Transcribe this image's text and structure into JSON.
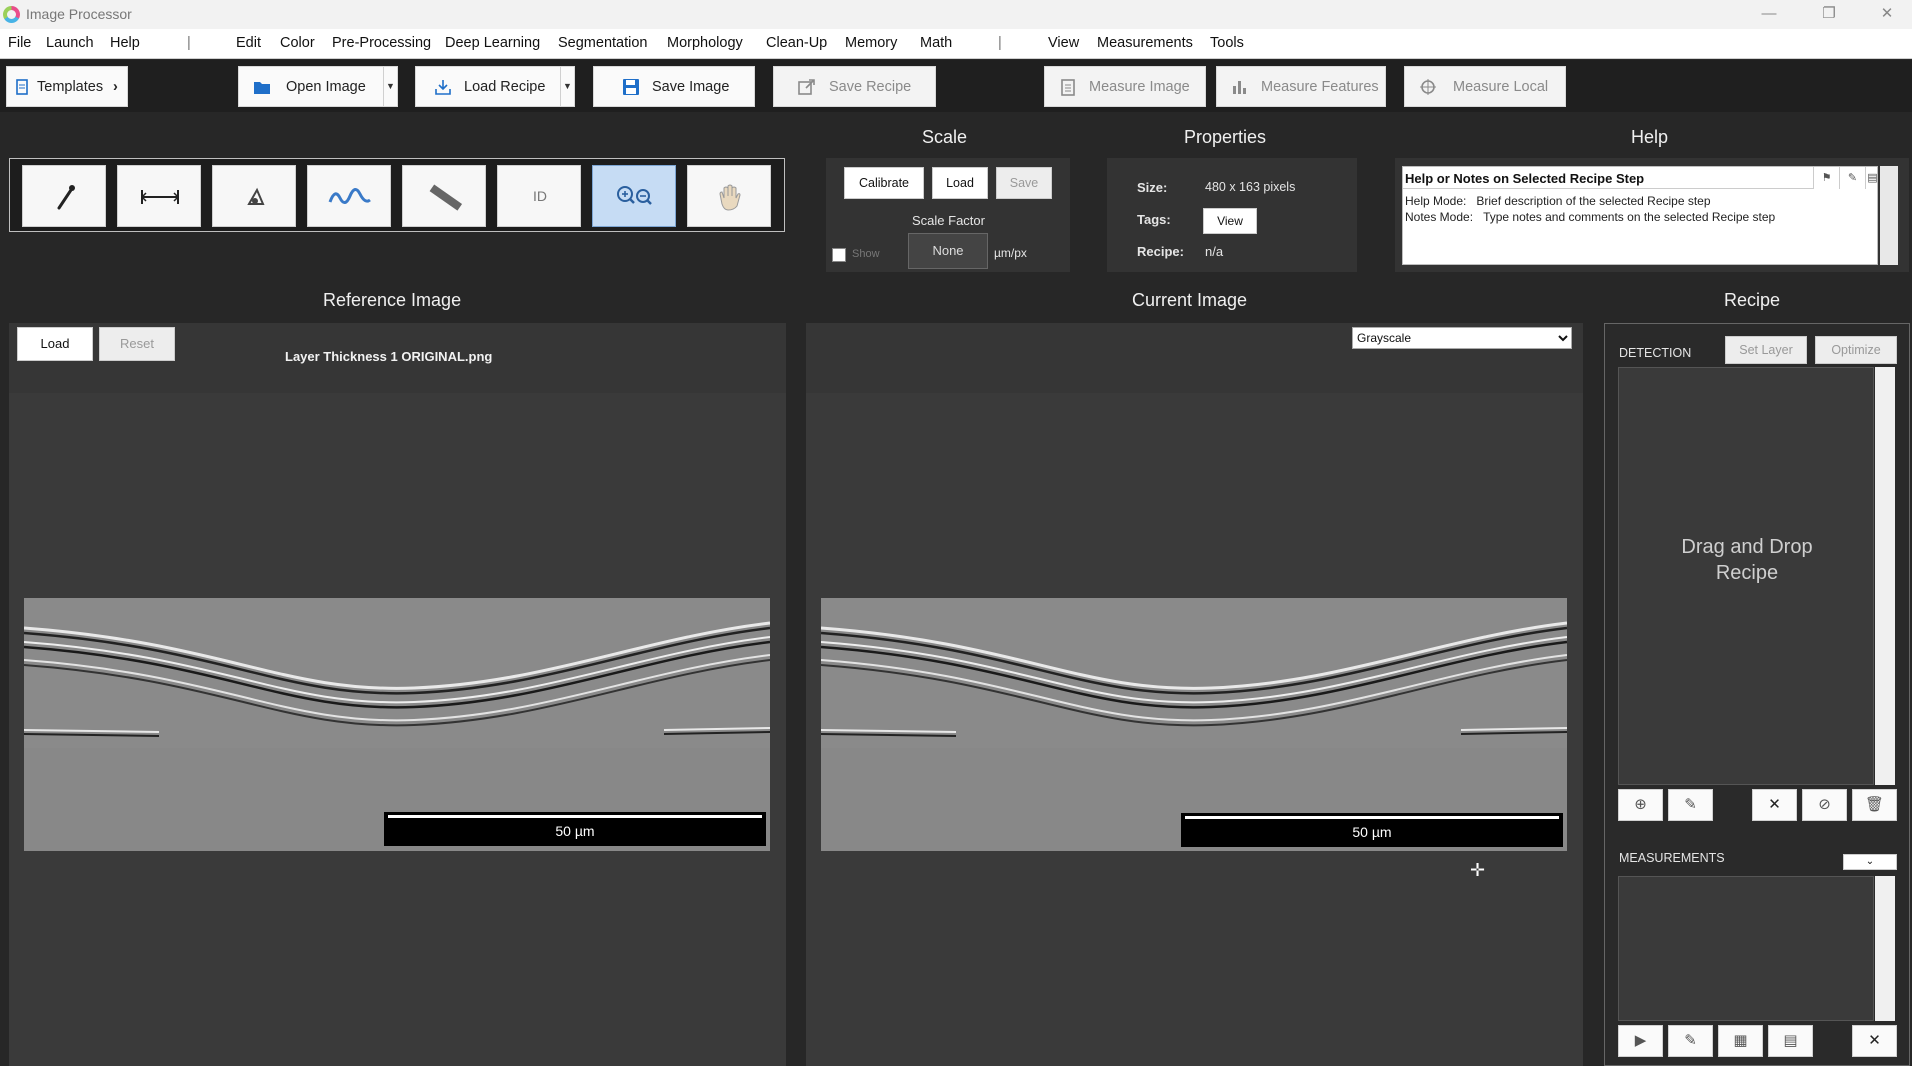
{
  "window": {
    "title": "Image Processor"
  },
  "menu": {
    "items": [
      "File",
      "Launch",
      "Help",
      "Edit",
      "Color",
      "Pre-Processing",
      "Deep Learning",
      "Segmentation",
      "Morphology",
      "Clean-Up",
      "Memory",
      "Math",
      "View",
      "Measurements",
      "Tools"
    ],
    "separator": "|"
  },
  "toolbar": {
    "templates": "Templates",
    "open_image": "Open Image",
    "load_recipe": "Load Recipe",
    "save_image": "Save Image",
    "save_recipe": "Save Recipe",
    "measure_image": "Measure Image",
    "measure_features": "Measure Features",
    "measure_local": "Measure Local"
  },
  "tools": {
    "id_label": "ID"
  },
  "scale": {
    "title": "Scale",
    "calibrate": "Calibrate",
    "load": "Load",
    "save": "Save",
    "factor_label": "Scale Factor",
    "show_label": "Show",
    "factor_value": "None",
    "unit": "µm/px"
  },
  "properties": {
    "title": "Properties",
    "size_label": "Size:",
    "size_value": "480 x 163 pixels",
    "tags_label": "Tags:",
    "tags_button": "View",
    "recipe_label": "Recipe:",
    "recipe_value": "n/a"
  },
  "help": {
    "title": "Help",
    "box_heading": "Help or Notes on Selected Recipe Step",
    "line1_key": "Help Mode:",
    "line1_text": "Brief description of the selected Recipe step",
    "line2_key": "Notes Mode:",
    "line2_text": "Type notes and comments on the selected Recipe step"
  },
  "reference": {
    "title": "Reference Image",
    "load": "Load",
    "reset": "Reset",
    "filename": "Layer Thickness 1 ORIGINAL.png",
    "scalebar": "50 µm"
  },
  "current": {
    "title": "Current Image",
    "mode": "Grayscale",
    "scalebar": "50 µm"
  },
  "recipe": {
    "title": "Recipe",
    "detection_label": "DETECTION",
    "set_layer": "Set Layer",
    "optimize": "Optimize",
    "drop_hint_1": "Drag and Drop",
    "drop_hint_2": "Recipe",
    "measurements_label": "MEASUREMENTS"
  },
  "colors": {
    "accent_blue": "#1f6fc9",
    "background": "#272727",
    "active_tool": "#c6dcf4"
  }
}
